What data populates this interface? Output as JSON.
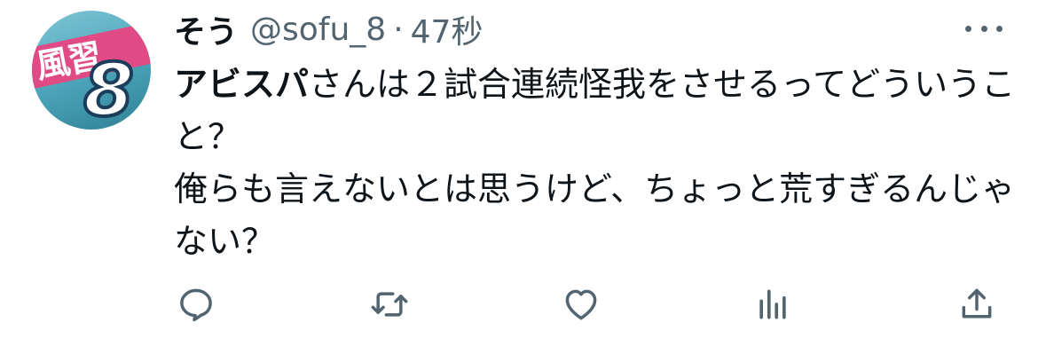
{
  "tweet": {
    "author": {
      "display_name": "そう",
      "handle": "@sofu_8",
      "avatar": {
        "text": "風習",
        "number": "8"
      }
    },
    "separator": "·",
    "timestamp": "47秒",
    "mention": "アビスパ",
    "text": "さんは２試合連続怪我をさせるってどういうこと？\n俺らも言えないとは思うけど、ちょっと荒すぎるんじゃない？"
  },
  "actions": {
    "reply_icon": "reply-icon",
    "retweet_icon": "retweet-icon",
    "like_icon": "heart-icon",
    "views_icon": "views-chart-icon",
    "share_icon": "share-icon",
    "icon_color": "#536471"
  }
}
